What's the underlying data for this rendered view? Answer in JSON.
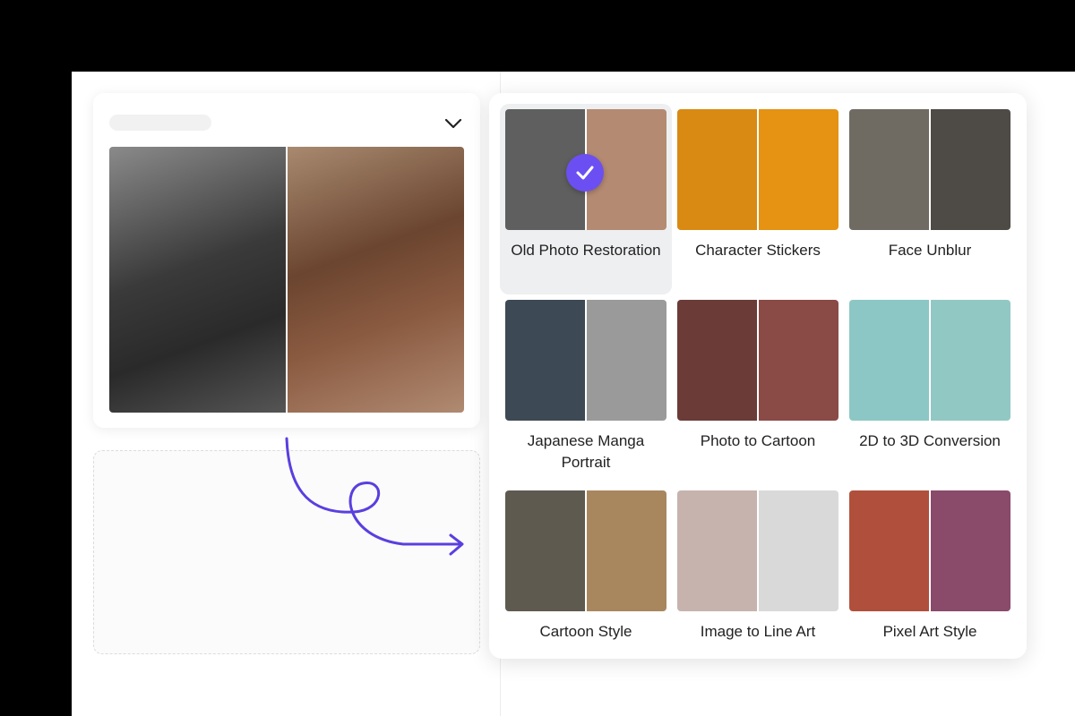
{
  "colors": {
    "accent": "#6c4ff2",
    "arrow": "#5a3fe0"
  },
  "preview": {
    "dropdown_icon": "chevron-down-icon"
  },
  "styles": [
    {
      "label": "Old Photo Restoration",
      "selected": true,
      "left": "#5f5f5f",
      "right": "#b48a72"
    },
    {
      "label": "Character Stickers",
      "selected": false,
      "left": "#d98a12",
      "right": "#e69212"
    },
    {
      "label": "Face Unblur",
      "selected": false,
      "left": "#6f6a62",
      "right": "#4e4a45"
    },
    {
      "label": "Japanese Manga Portrait",
      "selected": false,
      "left": "#3d4a55",
      "right": "#9a9a9a"
    },
    {
      "label": "Photo to Cartoon",
      "selected": false,
      "left": "#6b3b38",
      "right": "#8a4a46"
    },
    {
      "label": "2D to 3D Conversion",
      "selected": false,
      "left": "#8cc7c5",
      "right": "#92c8c4"
    },
    {
      "label": "Cartoon Style",
      "selected": false,
      "left": "#5e5a50",
      "right": "#a8875e"
    },
    {
      "label": "Image to Line Art",
      "selected": false,
      "left": "#c7b3ad",
      "right": "#d9d9d9"
    },
    {
      "label": "Pixel Art Style",
      "selected": false,
      "left": "#b0503c",
      "right": "#8a4a6a"
    }
  ]
}
